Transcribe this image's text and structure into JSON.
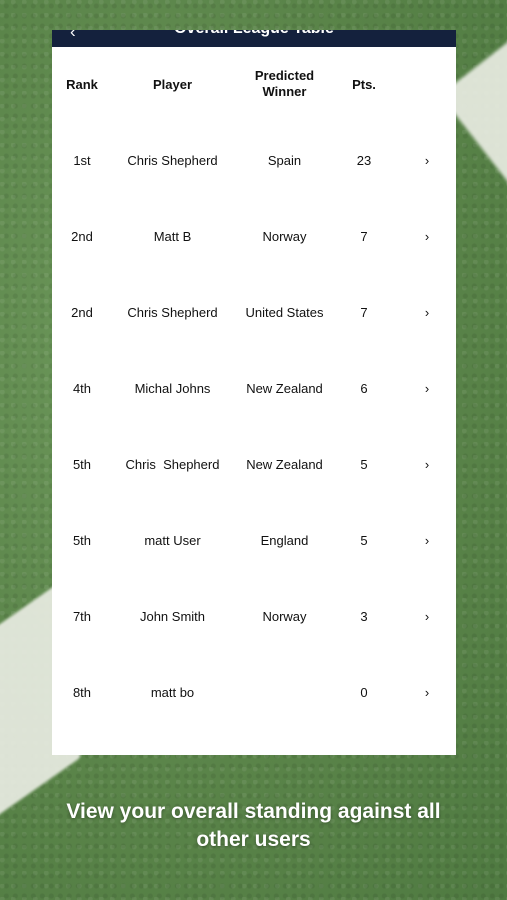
{
  "header": {
    "back_glyph": "‹",
    "title": "Overall League Table"
  },
  "table": {
    "columns": {
      "rank": "Rank",
      "player": "Player",
      "winner_line1": "Predicted",
      "winner_line2": "Winner",
      "points": "Pts."
    },
    "rows": [
      {
        "rank": "1st",
        "player": "Chris Shepherd",
        "winner": "Spain",
        "pts": "23"
      },
      {
        "rank": "2nd",
        "player": "Matt B",
        "winner": "Norway",
        "pts": "7"
      },
      {
        "rank": "2nd",
        "player": "Chris Shepherd",
        "winner": "United States",
        "pts": "7"
      },
      {
        "rank": "4th",
        "player": "Michal Johns",
        "winner": "New Zealand",
        "pts": "6"
      },
      {
        "rank": "5th",
        "player": "Chris  Shepherd",
        "winner": "New Zealand",
        "pts": "5"
      },
      {
        "rank": "5th",
        "player": "matt User",
        "winner": "England",
        "pts": "5"
      },
      {
        "rank": "7th",
        "player": "John Smith",
        "winner": "Norway",
        "pts": "3"
      },
      {
        "rank": "8th",
        "player": "matt bo",
        "winner": "",
        "pts": "0"
      }
    ],
    "chevron_glyph": "›"
  },
  "caption": {
    "line1": "View your overall standing against all",
    "line2": "other users"
  }
}
